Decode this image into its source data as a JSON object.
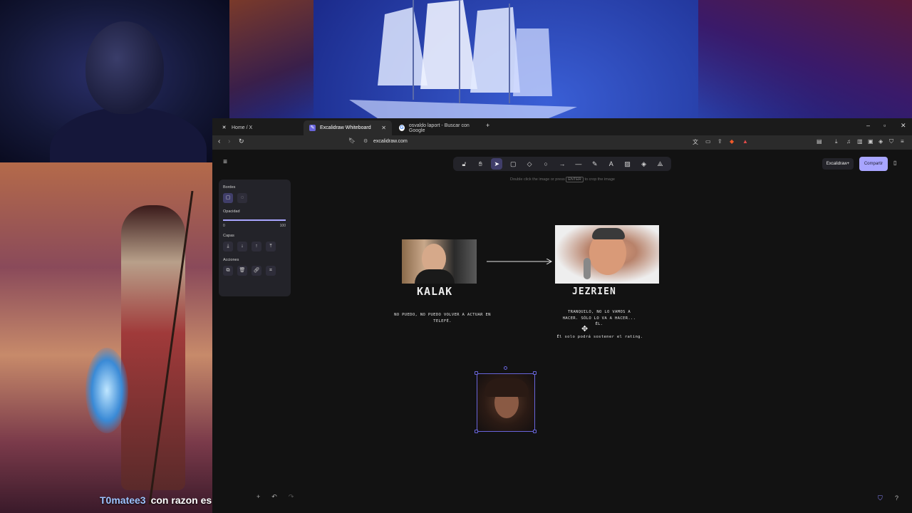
{
  "stream": {
    "chat": {
      "username": "T0matee3",
      "message": "con razon es en kick"
    }
  },
  "browser": {
    "tabs": [
      {
        "title": "Home / X",
        "icon": "x-logo-icon"
      },
      {
        "title": "Excalidraw Whiteboard",
        "icon": "excalidraw-logo-icon",
        "active": true
      },
      {
        "title": "osvaldo laport - Buscar con Google",
        "icon": "google-logo-icon"
      }
    ],
    "url": "excalidraw.com"
  },
  "excalidraw": {
    "hint_prefix": "Double click the image or press",
    "hint_key": "ENTER",
    "hint_suffix": "to crop the image",
    "library_label": "Excalidraw+",
    "share_label": "Compartir",
    "properties": {
      "borders_label": "Bordes",
      "opacity_label": "Opacidad",
      "opacity_min": "0",
      "opacity_max": "100",
      "opacity_value": 100,
      "layers_label": "Capas",
      "actions_label": "Acciones"
    },
    "canvas": {
      "kalak_title": "KALAK",
      "kalak_caption": "NO PUEDO, NO PUEDO VOLVER A ACTUAR EN TELEFÉ.",
      "jezrien_title": "JEZRIEN",
      "jezrien_caption_line1": "TRANQUILO, NO LO VAMOS A",
      "jezrien_caption_line2": "HACER. SÓLO LO VA A HACER...",
      "jezrien_caption_line3": "ÉL.",
      "jezrien_caption_line4": "Él solo podrá sostener el rating."
    }
  },
  "colors": {
    "accent": "#a8a5ff",
    "selection": "#6965db",
    "canvas_bg": "#121212",
    "chat_username": "#9ec4ff"
  }
}
